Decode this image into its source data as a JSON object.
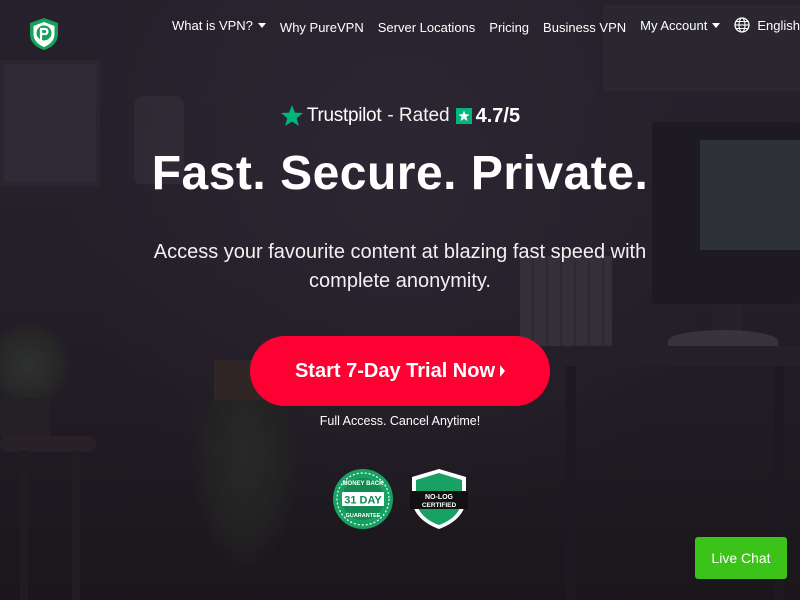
{
  "header": {
    "logo_name": "purevpn-logo",
    "nav": [
      {
        "label": "What is VPN?",
        "has_dropdown": true
      },
      {
        "label": "Why PureVPN",
        "has_dropdown": false
      },
      {
        "label": "Server Locations",
        "has_dropdown": false
      },
      {
        "label": "Pricing",
        "has_dropdown": false
      },
      {
        "label": "Business VPN",
        "has_dropdown": false
      },
      {
        "label": "My Account",
        "has_dropdown": true
      }
    ],
    "language": {
      "label": "English",
      "icon": "globe-icon"
    }
  },
  "hero": {
    "trustpilot": {
      "brand": "Trustpilot",
      "rated_text": "- Rated",
      "score": "4.7/5"
    },
    "headline": "Fast. Secure. Private.",
    "subheadline": "Access your favourite content at blazing fast speed with complete anonymity.",
    "cta_label": "Start 7-Day Trial Now",
    "cta_note": "Full Access. Cancel Anytime!",
    "badges": [
      {
        "name": "money-back-badge",
        "lines": [
          "MONEY BACK",
          "31 DAY",
          "GUARANTEE"
        ]
      },
      {
        "name": "no-log-certified-badge",
        "lines": [
          "NO-LOG",
          "CERTIFIED"
        ]
      }
    ]
  },
  "live_chat": {
    "label": "Live Chat"
  },
  "colors": {
    "cta_red": "#ff0033",
    "trustpilot_green": "#00b67a",
    "live_chat_green": "#3cc31a",
    "badge_green": "#17a163",
    "background_dark": "#2a2430"
  }
}
